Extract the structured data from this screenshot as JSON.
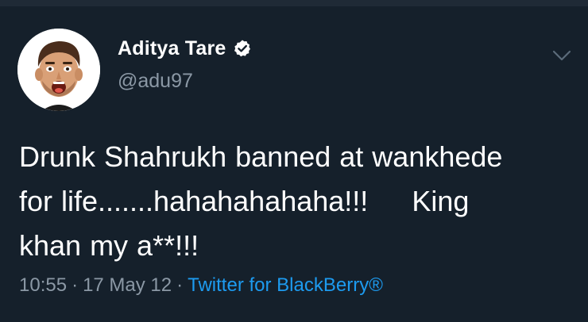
{
  "author": {
    "name": "Aditya Tare",
    "handle": "@adu97",
    "verified": true
  },
  "tweet": {
    "text": "Drunk Shahrukh banned at wankhede\nfor life.......hahahahahaha!!!     King\nkhan my a**!!!",
    "time": "10:55",
    "date": "17 May 12",
    "separator": "·",
    "source": "Twitter for BlackBerry®"
  },
  "icons": {
    "verified": "verified-badge-icon",
    "menu": "chevron-down-icon"
  },
  "colors": {
    "background": "#15202b",
    "text": "#ffffff",
    "muted": "#8b98a5",
    "link": "#1d9bf0"
  }
}
